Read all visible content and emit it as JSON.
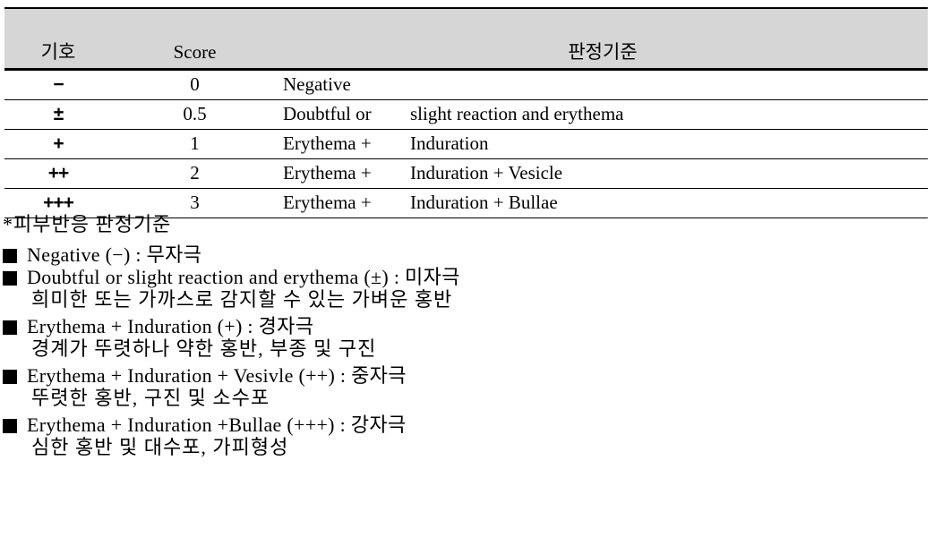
{
  "table": {
    "headers": {
      "symbol": "기호",
      "score": "Score",
      "criteria": "판정기준"
    },
    "rows": [
      {
        "symbol": "−",
        "score": "0",
        "desc_a": "Negative",
        "desc_b": ""
      },
      {
        "symbol": "±",
        "score": "0.5",
        "desc_a": "Doubtful or",
        "desc_b": "slight reaction and erythema"
      },
      {
        "symbol": "+",
        "score": "1",
        "desc_a": "Erythema +",
        "desc_b": "Induration"
      },
      {
        "symbol": "++",
        "score": "2",
        "desc_a": "Erythema +",
        "desc_b": "Induration + Vesicle"
      },
      {
        "symbol": "+++",
        "score": "3",
        "desc_a": "Erythema +",
        "desc_b": "Induration + Bullae"
      }
    ]
  },
  "notes": {
    "title": "*피부반응 판정기준",
    "items": [
      {
        "head": "Negative (−) : 무자극",
        "sub": ""
      },
      {
        "head": "Doubtful or slight reaction and erythema (±) : 미자극",
        "sub": "희미한 또는 가까스로 감지할 수 있는 가벼운 홍반"
      },
      {
        "head": "Erythema + Induration (+) : 경자극",
        "sub": "경계가 뚜렷하나 약한 홍반, 부종 및 구진"
      },
      {
        "head": "Erythema + Induration + Vesivle (++) : 중자극",
        "sub": "뚜렷한 홍반, 구진 및 소수포"
      },
      {
        "head": "Erythema + Induration +Bullae (+++) : 강자극",
        "sub": "심한 홍반 및 대수포, 가피형성"
      }
    ]
  },
  "colors": {
    "header_band": "#d6d6d6",
    "rule": "#000000",
    "text": "#000000"
  }
}
